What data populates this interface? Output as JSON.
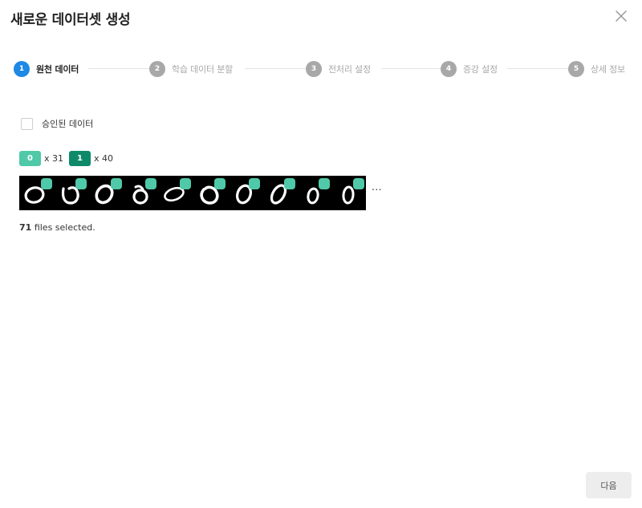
{
  "dialog": {
    "title": "새로운 데이터셋 생성",
    "close_icon": "close-icon"
  },
  "stepper": {
    "active_step": 1,
    "steps": [
      {
        "number": "1",
        "label": "원천 데이터"
      },
      {
        "number": "2",
        "label": "학습 데이터 분할"
      },
      {
        "number": "3",
        "label": "전처리 설정"
      },
      {
        "number": "4",
        "label": "증강 설정"
      },
      {
        "number": "5",
        "label": "상세 정보"
      }
    ],
    "colors": {
      "active": "#1e88e5",
      "inactive": "#a8a8a8",
      "line": "#e3e3e3"
    }
  },
  "filter": {
    "approved_label": "승인된 데이터",
    "approved_checked": false
  },
  "label_summary": [
    {
      "label": "0",
      "count_text": "x 31",
      "color": "#4fc9a8"
    },
    {
      "label": "1",
      "count_text": "x 40",
      "color": "#0e8a6a"
    }
  ],
  "thumbnails": {
    "label_dot_color": "#4fc9a8",
    "shown_count": 10,
    "more_indicator": "..."
  },
  "selection": {
    "count": "71",
    "suffix": "files selected."
  },
  "footer": {
    "next_label": "다음"
  }
}
